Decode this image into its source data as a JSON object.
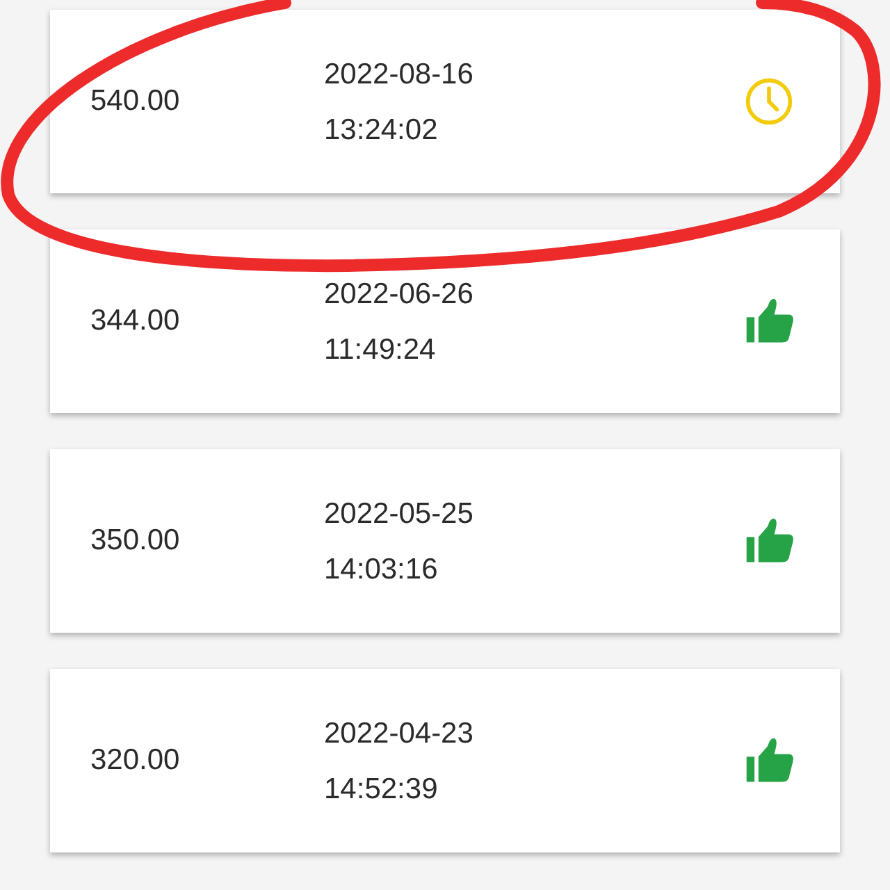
{
  "records": [
    {
      "amount": "540.00",
      "date": "2022-08-16",
      "time": "13:24:02",
      "kind": "pending"
    },
    {
      "amount": "344.00",
      "date": "2022-06-26",
      "time": "11:49:24",
      "kind": "approved"
    },
    {
      "amount": "350.00",
      "date": "2022-05-25",
      "time": "14:03:16",
      "kind": "approved"
    },
    {
      "amount": "320.00",
      "date": "2022-04-23",
      "time": "14:52:39",
      "kind": "approved"
    }
  ]
}
